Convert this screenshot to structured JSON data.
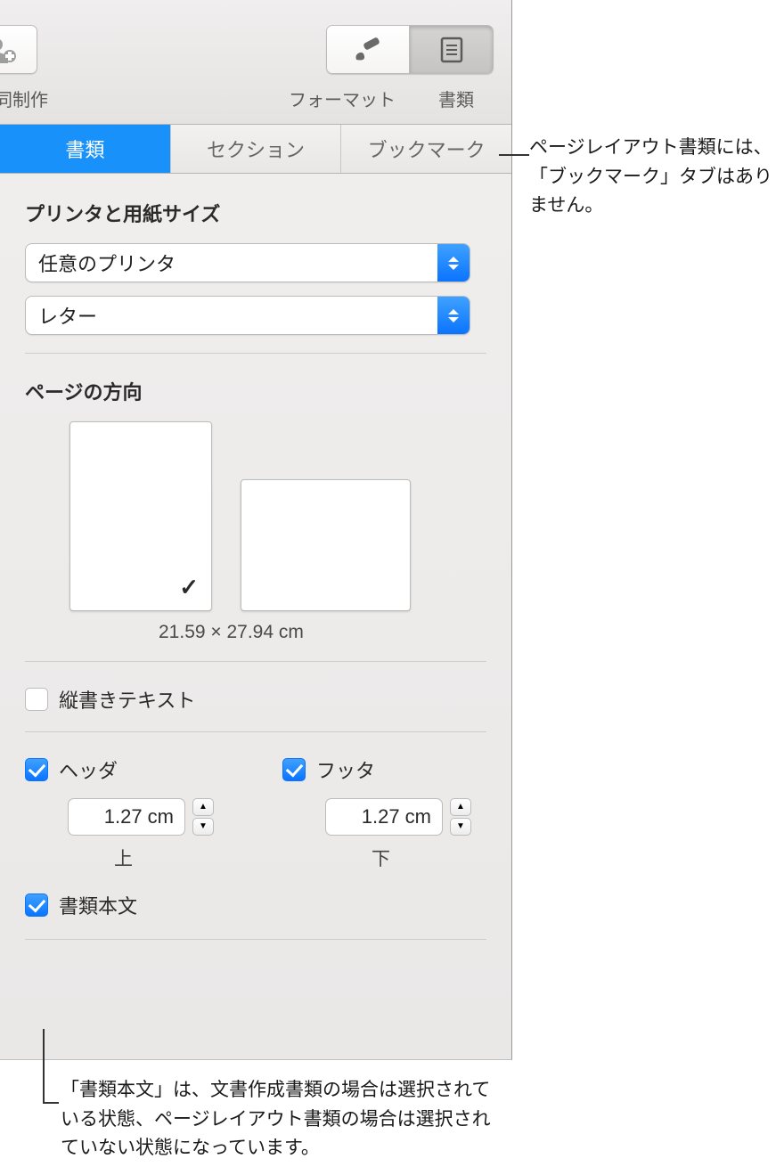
{
  "toolbar": {
    "collab_label": "同制作",
    "format_label": "フォーマット",
    "document_label": "書類"
  },
  "tabs": {
    "document": "書類",
    "section": "セクション",
    "bookmark": "ブックマーク"
  },
  "printer": {
    "section_title": "プリンタと用紙サイズ",
    "printer_value": "任意のプリンタ",
    "paper_value": "レター"
  },
  "orientation": {
    "section_title": "ページの方向",
    "dimensions": "21.59 × 27.94 cm"
  },
  "vertical_text": {
    "label": "縦書きテキスト",
    "checked": false
  },
  "header": {
    "label": "ヘッダ",
    "checked": true,
    "value": "1.27 cm",
    "sub": "上"
  },
  "footer": {
    "label": "フッタ",
    "checked": true,
    "value": "1.27 cm",
    "sub": "下"
  },
  "body": {
    "label": "書類本文",
    "checked": true
  },
  "callouts": {
    "c1": "ページレイアウト書類には、「ブックマーク」タブはありません。",
    "c2": "「書類本文」は、文書作成書類の場合は選択されている状態、ページレイアウト書類の場合は選択されていない状態になっています。"
  }
}
